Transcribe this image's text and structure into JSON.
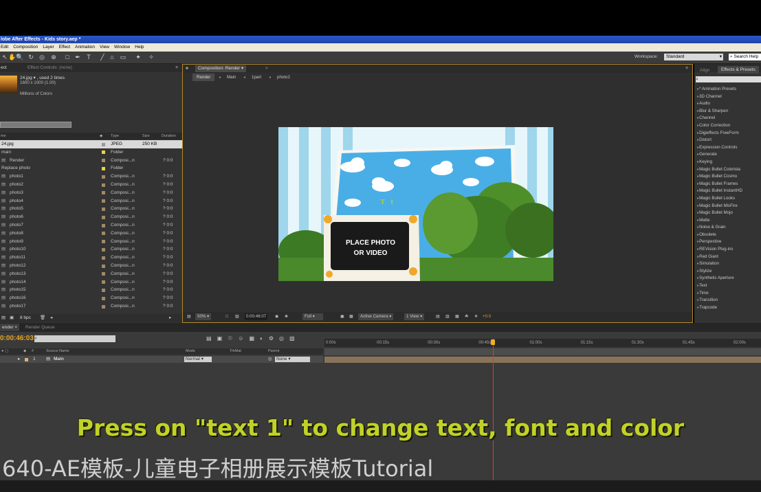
{
  "app": {
    "title": "lobe After Effects - Kids story.aep *"
  },
  "menu": [
    "Edit",
    "Composition",
    "Layer",
    "Effect",
    "Animation",
    "View",
    "Window",
    "Help"
  ],
  "toolbar": {
    "workspace_label": "Workspace:",
    "workspace_value": "Standard",
    "search_help": "Search Help"
  },
  "project_panel": {
    "tab_project": "ect",
    "tab_effect_controls": "Effect Controls: (none)",
    "file_info_line1": "24.jpg ▾ , used 2 times",
    "file_info_line2": "1600 x 1000 (1.00)",
    "file_info_line3": "Millions of Colors",
    "columns": {
      "name": "me",
      "type": "Type",
      "size": "Size",
      "duration": "Duration"
    },
    "items": [
      {
        "name": "24.jpg",
        "type": "JPEG",
        "size": "250 KB",
        "duration": "",
        "color": "#9a9a9a",
        "selected": true
      },
      {
        "name": "main",
        "type": "Folder",
        "size": "",
        "duration": "",
        "color": "#e8d34a"
      },
      {
        "name": "Render",
        "type": "Composi...n",
        "size": "",
        "duration": "? 0:0",
        "color": "#a08a6a"
      },
      {
        "name": "Replace photo",
        "type": "Folder",
        "size": "",
        "duration": "",
        "color": "#e8d34a"
      },
      {
        "name": "photo1",
        "type": "Composi...n",
        "size": "",
        "duration": "? 0:0",
        "color": "#a08a6a"
      },
      {
        "name": "photo2",
        "type": "Composi...n",
        "size": "",
        "duration": "? 0:0",
        "color": "#a08a6a"
      },
      {
        "name": "photo3",
        "type": "Composi...n",
        "size": "",
        "duration": "? 0:0",
        "color": "#a08a6a"
      },
      {
        "name": "photo4",
        "type": "Composi...n",
        "size": "",
        "duration": "? 0:0",
        "color": "#a08a6a"
      },
      {
        "name": "photo5",
        "type": "Composi...n",
        "size": "",
        "duration": "? 0:0",
        "color": "#a08a6a"
      },
      {
        "name": "photo6",
        "type": "Composi...n",
        "size": "",
        "duration": "? 0:0",
        "color": "#a08a6a"
      },
      {
        "name": "photo7",
        "type": "Composi...n",
        "size": "",
        "duration": "? 0:0",
        "color": "#a08a6a"
      },
      {
        "name": "photo8",
        "type": "Composi...n",
        "size": "",
        "duration": "? 0:0",
        "color": "#a08a6a"
      },
      {
        "name": "photo9",
        "type": "Composi...n",
        "size": "",
        "duration": "? 0:0",
        "color": "#a08a6a"
      },
      {
        "name": "photo10",
        "type": "Composi...n",
        "size": "",
        "duration": "? 0:0",
        "color": "#a08a6a"
      },
      {
        "name": "photo11",
        "type": "Composi...n",
        "size": "",
        "duration": "? 0:0",
        "color": "#a08a6a"
      },
      {
        "name": "photo12",
        "type": "Composi...n",
        "size": "",
        "duration": "? 0:0",
        "color": "#a08a6a"
      },
      {
        "name": "photo13",
        "type": "Composi...n",
        "size": "",
        "duration": "? 0:0",
        "color": "#a08a6a"
      },
      {
        "name": "photo14",
        "type": "Composi...n",
        "size": "",
        "duration": "? 0:0",
        "color": "#a08a6a"
      },
      {
        "name": "photo15",
        "type": "Composi...n",
        "size": "",
        "duration": "? 0:0",
        "color": "#a08a6a"
      },
      {
        "name": "photo16",
        "type": "Composi...n",
        "size": "",
        "duration": "? 0:0",
        "color": "#a08a6a"
      },
      {
        "name": "photo17",
        "type": "Composi...n",
        "size": "",
        "duration": "? 0:0",
        "color": "#a08a6a"
      }
    ],
    "bpc": "8 bpc"
  },
  "composition": {
    "tab": "Composition: Render",
    "breadcrumbs": [
      "Render",
      "Main",
      "1part",
      "photo2"
    ],
    "placeholder_line1": "PLACE PHOTO",
    "placeholder_line2": "OR VIDEO",
    "text_glyphs": "T   t",
    "zoom": "50%",
    "timecode": "0:00:46:07",
    "resolution": "Full",
    "camera": "Active Camera",
    "view": "1 View",
    "exposure": "+0.0"
  },
  "effects_panel": {
    "tab_align": "Align",
    "tab_effects": "Effects & Presets",
    "categories": [
      "* Animation Presets",
      "3D Channel",
      "Audio",
      "Blur & Sharpen",
      "Channel",
      "Color Correction",
      "Digieffects FreeForm",
      "Distort",
      "Expression Controls",
      "Generate",
      "Keying",
      "Magic Bullet Colorista",
      "Magic Bullet Cosmo",
      "Magic Bullet Frames",
      "Magic Bullet InstantHD",
      "Magic Bullet Looks",
      "Magic Bullet MisFire",
      "Magic Bullet Mojo",
      "Matte",
      "Noise & Grain",
      "Obsolete",
      "Perspective",
      "REVision Plug-ins",
      "Red Giant",
      "Simulation",
      "Stylize",
      "Synthetic Aperture",
      "Text",
      "Time",
      "Transition",
      "Trapcode"
    ]
  },
  "timeline": {
    "tab_render": "ender",
    "tab_render_queue": "Render Queue",
    "current_time": "0:00:46:03",
    "columns": {
      "source": "Source Name",
      "mode": "Mode",
      "trkmat": "TrkMat",
      "parent": "Parent"
    },
    "layer": {
      "index": "1",
      "name": "Main",
      "mode": "Normal",
      "parent": "None"
    },
    "ticks": [
      "0:00s",
      "00:15s",
      "00:30s",
      "00:45s",
      "01:00s",
      "01:15s",
      "01:30s",
      "01:45s",
      "02:00s"
    ],
    "playhead_fraction": 0.386
  },
  "overlay": {
    "subtitle": "Press on \"text 1\" to change text, font and color",
    "watermark": "640-AE模板-儿童电子相册展示模板Tutorial"
  }
}
